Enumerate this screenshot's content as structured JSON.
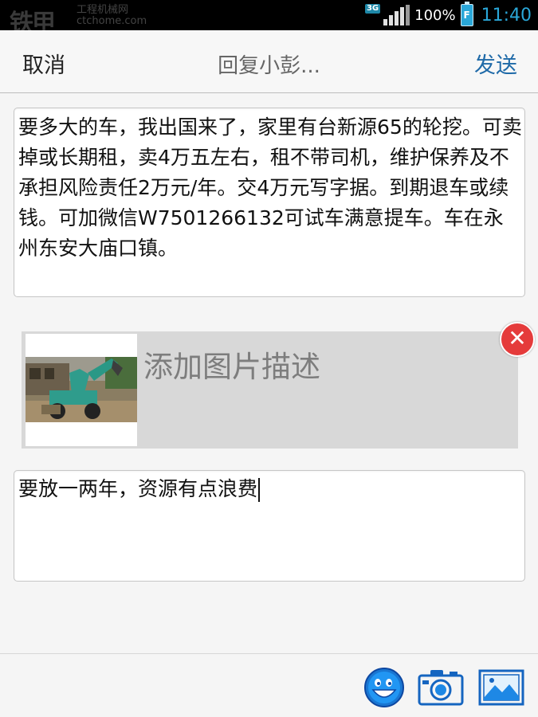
{
  "status_bar": {
    "watermark": "铁甲",
    "watermark_sub": "工程机械网",
    "watermark_sub2": "ctchome.com",
    "network": "3G",
    "battery": "100%",
    "battery_letter": "F",
    "time": "11:40"
  },
  "header": {
    "cancel": "取消",
    "title": "回复小彭...",
    "send": "发送"
  },
  "quoted_post": {
    "text": "要多大的车，我出国来了，家里有台新源65的轮挖。可卖掉或长期租，卖4万五左右，租不带司机，维护保养及不承担风险责任2万元/年。交4万元写字据。到期退车或续钱。可加微信W7501266132可试车满意提车。车在永州东安大庙口镇。"
  },
  "attachment": {
    "description_placeholder": "添加图片描述",
    "remove_icon": "close-icon"
  },
  "reply": {
    "text": "要放一两年，资源有点浪费"
  },
  "toolbar": {
    "icons": [
      "emoji-icon",
      "camera-icon",
      "gallery-icon"
    ]
  },
  "colors": {
    "send": "#1f6aa8",
    "status_time": "#2aa7d8",
    "remove": "#e53b3b"
  }
}
